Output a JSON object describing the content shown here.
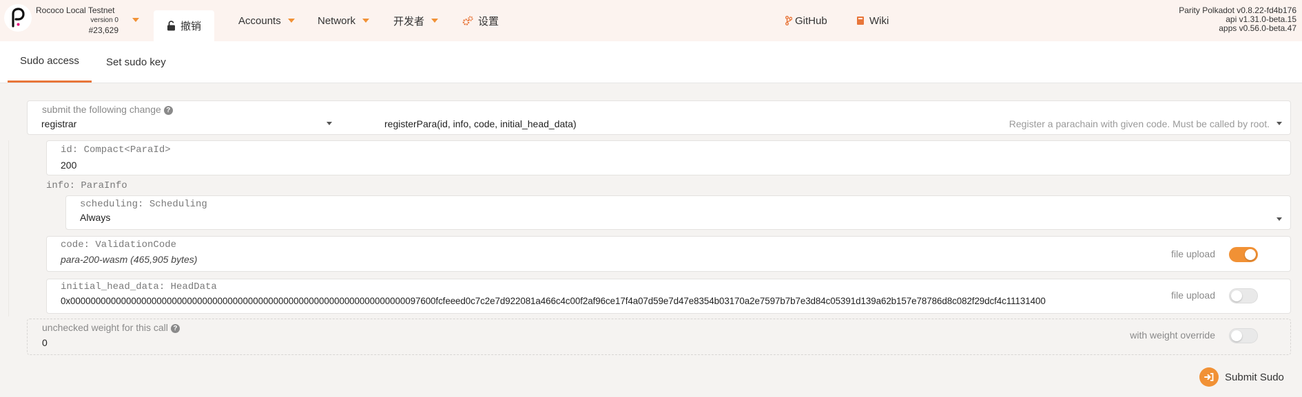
{
  "header": {
    "chain_name": "Rococo Local Testnet",
    "chain_version": "version 0",
    "block_number": "#23,629",
    "nav": {
      "active_item": "撤销",
      "accounts": "Accounts",
      "network": "Network",
      "developer": "开发者",
      "settings": "设置",
      "github": "GitHub",
      "wiki": "Wiki"
    },
    "versions": {
      "node": "Parity Polkadot v0.8.22-fd4b176",
      "api": "api v1.31.0-beta.15",
      "apps": "apps v0.56.0-beta.47"
    }
  },
  "tabs": [
    "Sudo access",
    "Set sudo key"
  ],
  "form": {
    "submit_label": "submit the following change",
    "module": "registrar",
    "method": "registerPara(id, info, code, initial_head_data)",
    "method_description": "Register a parachain with given code. Must be called by root.",
    "params": {
      "id_label": "id: Compact<ParaId>",
      "id_value": "200",
      "info_label": "info: ParaInfo",
      "scheduling_label": "scheduling: Scheduling",
      "scheduling_value": "Always",
      "code_label": "code: ValidationCode",
      "code_value": "para-200-wasm (465,905 bytes)",
      "code_upload_label": "file upload",
      "code_upload_on": true,
      "head_label": "initial_head_data: HeadData",
      "head_value": "0x000000000000000000000000000000000000000000000000000000000000000000097600fcfeeed0c7c2e7d922081a466c4c00f2af96ce17f4a07d59e7d47e8354b03170a2e7597b7b7e3d84c05391d139a62b157e78786d8c082f29dcf4c11131400",
      "head_upload_label": "file upload",
      "head_upload_on": false
    },
    "weight": {
      "label": "unchecked weight for this call",
      "value": "0",
      "override_label": "with weight override",
      "override_on": false
    },
    "submit_button": "Submit Sudo"
  },
  "colors": {
    "accent": "#f19135",
    "tab_underline": "#e8763a",
    "header_bg": "#fcf3ef",
    "page_bg": "#f5f3f1"
  }
}
